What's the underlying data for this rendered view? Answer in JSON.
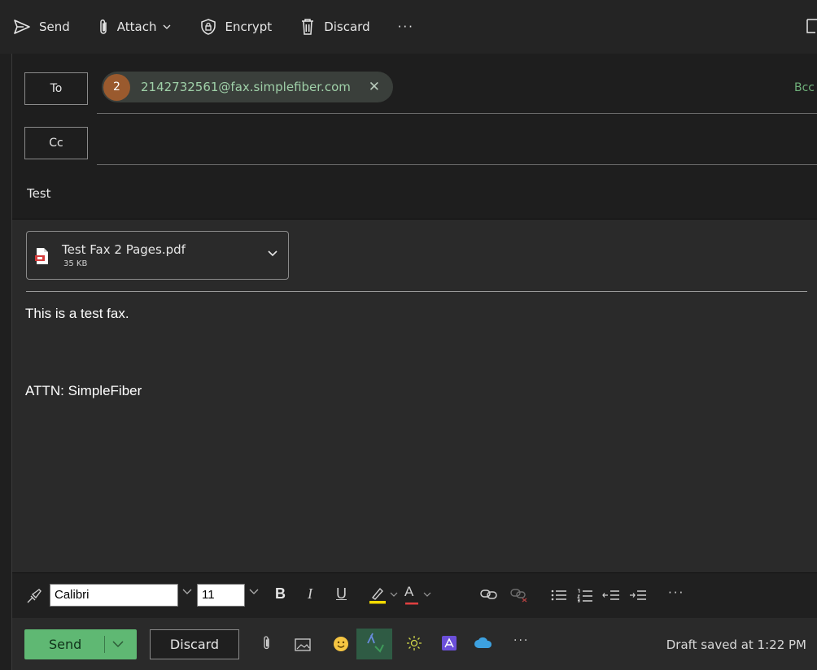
{
  "toolbar": {
    "send_label": "Send",
    "attach_label": "Attach",
    "encrypt_label": "Encrypt",
    "discard_label": "Discard",
    "more_label": "···"
  },
  "compose": {
    "to_label": "To",
    "cc_label": "Cc",
    "bcc_label": "Bcc",
    "recipient": {
      "avatar_text": "2",
      "email": "2142732561@fax.simplefiber.com",
      "remove_glyph": "✕"
    },
    "subject_value": "Test"
  },
  "attachment": {
    "name": "Test Fax 2 Pages.pdf",
    "size": "35 KB"
  },
  "body": {
    "lines": [
      "This is a test fax.",
      "ATTN: SimpleFiber"
    ]
  },
  "format_bar": {
    "font": "Calibri",
    "size": "11",
    "bold_label": "B",
    "italic_label": "I",
    "underline_label": "U",
    "font_color_label": "A",
    "more_label": "···"
  },
  "bottom_bar": {
    "send_label": "Send",
    "discard_label": "Discard",
    "more_label": "···",
    "status": "Draft saved at 1:22 PM"
  },
  "colors": {
    "accent_green": "#5fb873",
    "chip_text": "#9fd0a8",
    "avatar": "#9a5a2e",
    "highlight_yellow": "#f2d900",
    "font_color_red": "#e04040"
  }
}
